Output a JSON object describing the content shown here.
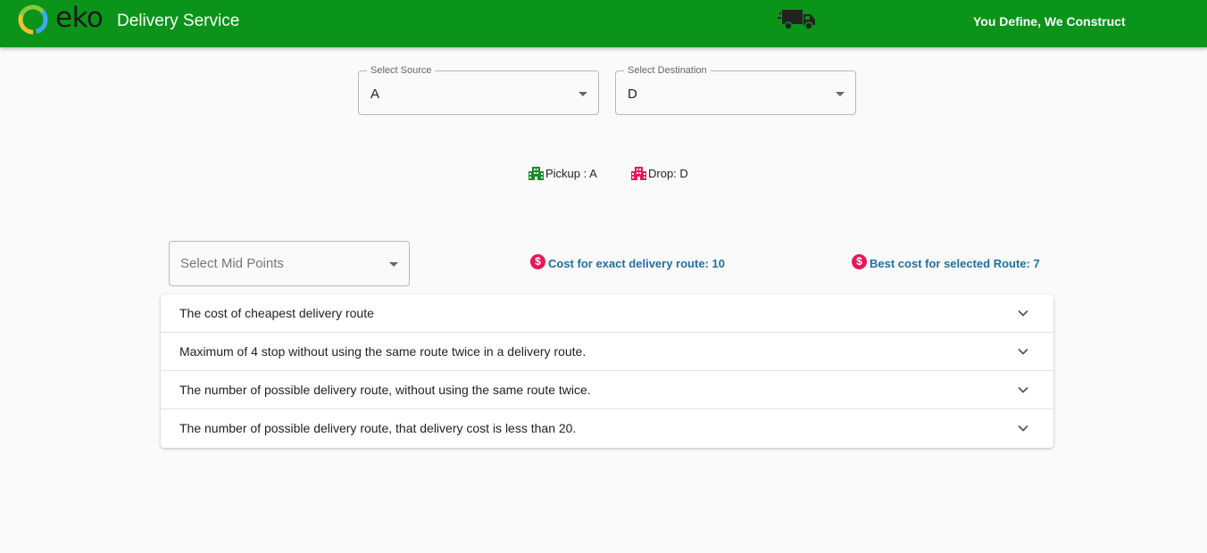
{
  "header": {
    "logo_text": "eko",
    "title": "Delivery Service",
    "slogan": "You Define, We Construct",
    "truck_icon": "truck-icon",
    "bar_color": "#0a9419"
  },
  "source": {
    "label": "Select Source",
    "value": "A"
  },
  "destination": {
    "label": "Select Destination",
    "value": "D"
  },
  "markers": {
    "pickup_text": "Pickup : A",
    "drop_text": "Drop: D",
    "pickup_color": "#1e8a2a",
    "drop_color": "#e6195a"
  },
  "midpoints": {
    "placeholder": "Select Mid Points"
  },
  "costs": {
    "exact_text": "Cost for exact delivery route: 10",
    "best_text": "Best cost for selected Route: 7",
    "icon": "dollar-icon"
  },
  "accordion": [
    {
      "label": "The cost of cheapest delivery route"
    },
    {
      "label": "Maximum of 4 stop without using the same route twice in a delivery route."
    },
    {
      "label": "The number of possible delivery route, without using the same route twice."
    },
    {
      "label": "The number of possible delivery route, that delivery cost is less than 20."
    }
  ]
}
